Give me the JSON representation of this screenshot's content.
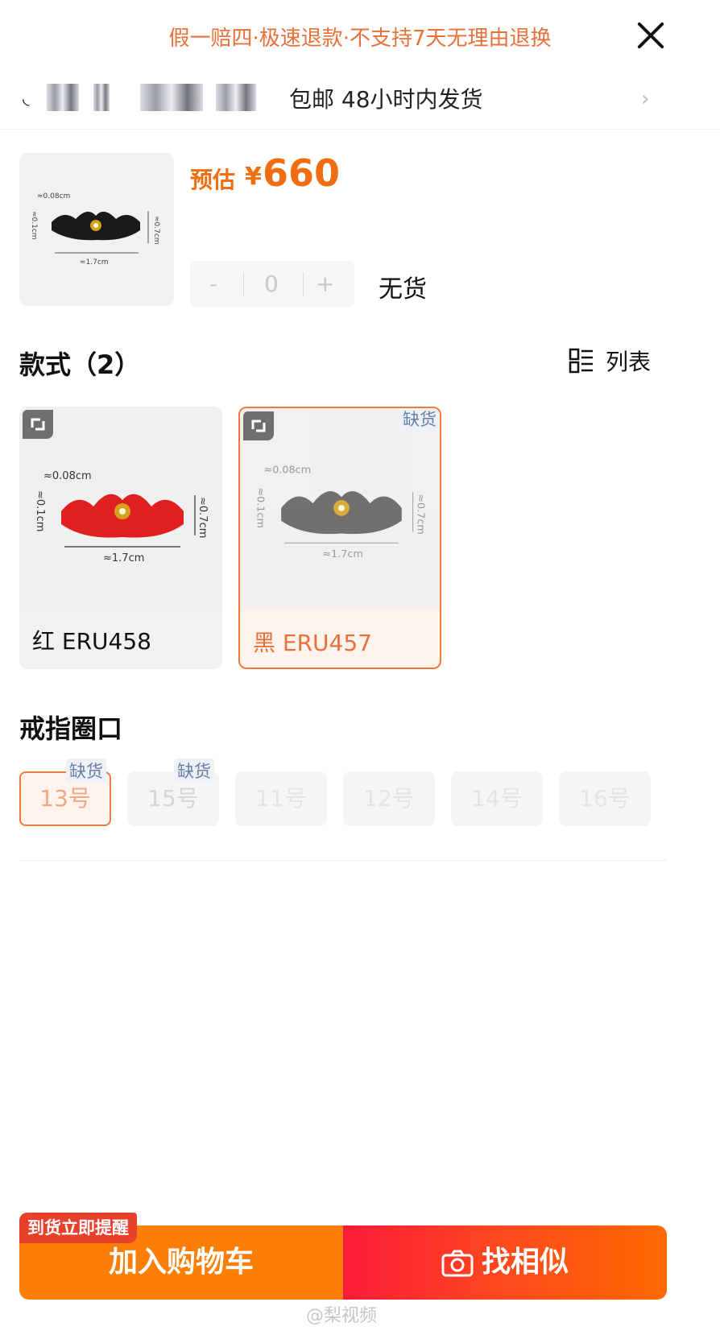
{
  "header": {
    "banner": "假一赔四·极速退款·不支持7天无理由退换",
    "shipping": "包邮 48小时内发货"
  },
  "product": {
    "price_label": "预估",
    "currency": "¥",
    "price": "660",
    "stepper": {
      "minus": "-",
      "value": "0",
      "plus": "+"
    },
    "stock_status": "无货"
  },
  "styles": {
    "title": "款式（2）",
    "view_toggle": "列表",
    "items": [
      {
        "label": "红 ERU458",
        "color": "#e02020",
        "selected": false
      },
      {
        "label": "黑 ERU457",
        "color": "#5a5a5a",
        "selected": true,
        "badge": "缺货"
      }
    ]
  },
  "ring_size": {
    "title": "戒指圈口",
    "options": [
      {
        "label": "13号",
        "badge": "缺货",
        "selected": true
      },
      {
        "label": "15号",
        "badge": "缺货",
        "selected": false
      },
      {
        "label": "11号",
        "selected": false
      },
      {
        "label": "12号",
        "selected": false
      },
      {
        "label": "14号",
        "selected": false
      },
      {
        "label": "16号",
        "selected": false
      }
    ]
  },
  "product_image_labels": {
    "width": "≈1.7cm",
    "height": "≈0.7cm",
    "thickness": "≈0.1cm",
    "gap": "≈0.08cm"
  },
  "footer": {
    "remind": "到货立即提醒",
    "add_to_cart": "加入购物车",
    "find_similar": "找相似",
    "watermark": "@梨视频"
  },
  "colors": {
    "accent": "#f06d12",
    "cart": "#fb7f06",
    "similar": "#fb1b38",
    "badge": "#6a7fa8"
  }
}
